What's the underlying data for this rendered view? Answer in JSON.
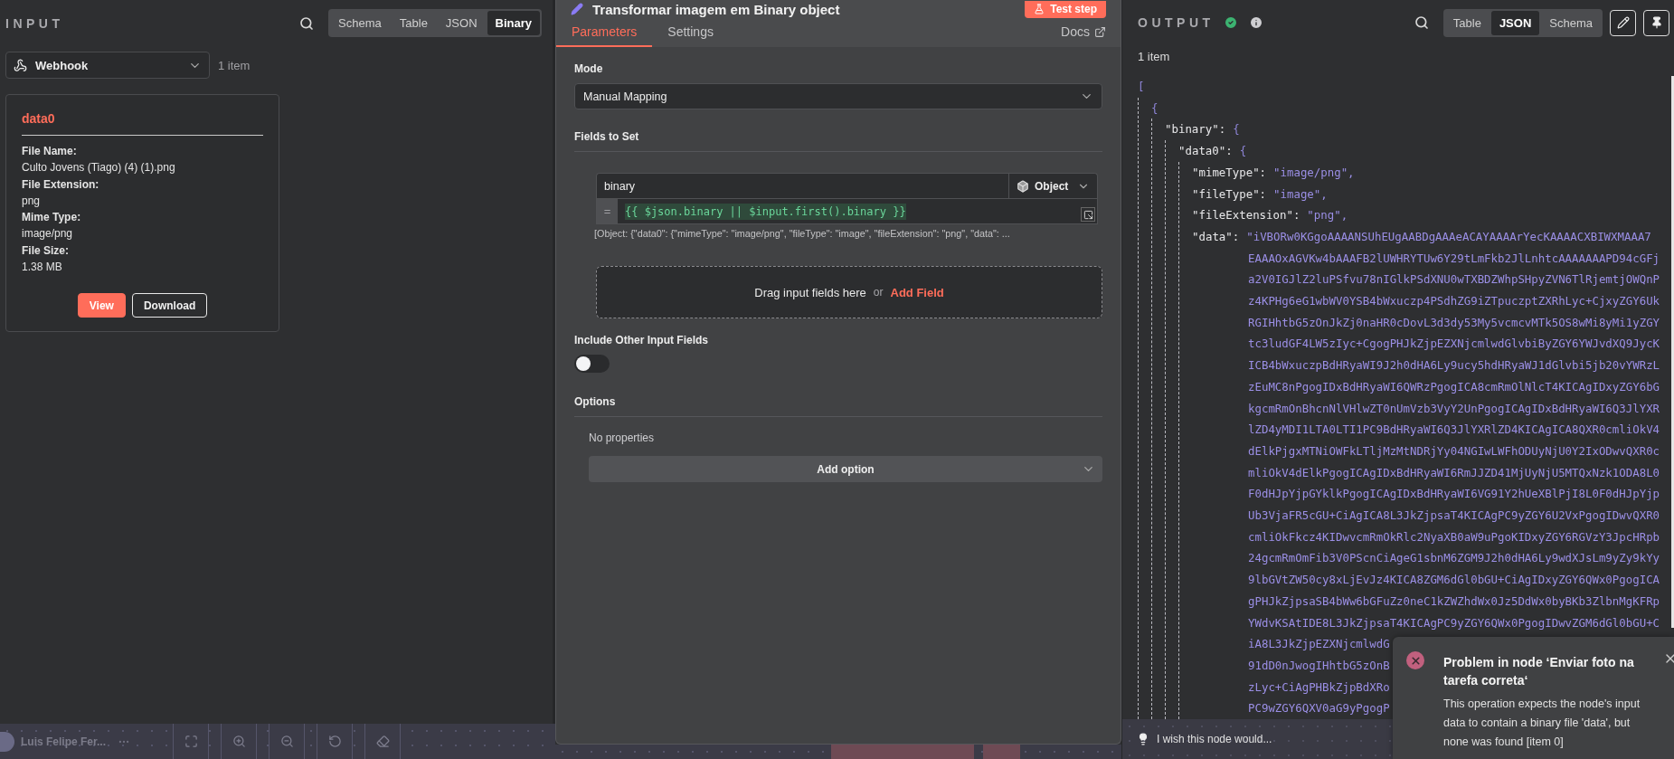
{
  "input": {
    "title": "INPUT",
    "view_tabs": [
      {
        "label": "Schema",
        "selected": false
      },
      {
        "label": "Table",
        "selected": false
      },
      {
        "label": "JSON",
        "selected": false
      },
      {
        "label": "Binary",
        "selected": true
      }
    ],
    "source": {
      "value": "Webhook"
    },
    "item_count": "1 item",
    "files": [
      {
        "name": "data0",
        "fields": [
          {
            "label": "File Name:",
            "value": "Culto Jovens (Tiago) (4) (1).png"
          },
          {
            "label": "File Extension:",
            "value": "png"
          },
          {
            "label": "Mime Type:",
            "value": "image/png"
          },
          {
            "label": "File Size:",
            "value": "1.38 MB"
          }
        ],
        "buttons": [
          {
            "label": "View",
            "kind": "primary"
          },
          {
            "label": "Download",
            "kind": "outline"
          }
        ]
      }
    ]
  },
  "node": {
    "title": "Transformar imagem em Binary object",
    "test_button": "Test step",
    "tabs": [
      {
        "label": "Parameters",
        "selected": true
      },
      {
        "label": "Settings",
        "selected": false
      }
    ],
    "docs_link": "Docs",
    "mode": {
      "label": "Mode",
      "value": "Manual Mapping"
    },
    "fields_to_set": {
      "label": "Fields to Set",
      "fields": [
        {
          "name": "binary",
          "type": "Object",
          "operator": "=",
          "expression": "{{ $json.binary || $input.first().binary }}",
          "preview": "[Object: {\"data0\": {\"mimeType\": \"image/png\", \"fileType\": \"image\", \"fileExtension\": \"png\", \"data\": ..."
        }
      ],
      "dropzone": {
        "text": "Drag input fields here",
        "separator": "or",
        "link": "Add Field"
      }
    },
    "include_other": {
      "label": "Include Other Input Fields",
      "on": false
    },
    "options": {
      "label": "Options",
      "empty_text": "No properties",
      "add_button": "Add option"
    }
  },
  "output": {
    "title": "OUTPUT",
    "view_tabs": [
      {
        "label": "Table",
        "selected": false
      },
      {
        "label": "JSON",
        "selected": true
      },
      {
        "label": "Schema",
        "selected": false
      }
    ],
    "item_count": "1 item",
    "json_tree": [
      {
        "kind": "open",
        "text": "[",
        "children": [
          {
            "kind": "open",
            "text": "{",
            "children": [
              {
                "kind": "open",
                "key": "\"binary\":",
                "text": "{",
                "children": [
                  {
                    "kind": "open",
                    "key": "\"data0\":",
                    "text": "{",
                    "children": [
                      {
                        "kind": "value",
                        "key": "\"mimeType\":",
                        "text": "\"image/png\","
                      },
                      {
                        "kind": "value",
                        "key": "\"fileType\":",
                        "text": "\"image\","
                      },
                      {
                        "kind": "value",
                        "key": "\"fileExtension\":",
                        "text": "\"png\","
                      },
                      {
                        "kind": "multiline",
                        "key": "\"data\":",
                        "text": "\"iVBORw0KGgoAAAANSUhEUgAABDgAAAeACAYAAAArYecKAAAACXBIWXMAAA7",
                        "lines": [
                          "EAAAOxAGVKw4bAAAFB2lUWHRYTUw6Y29tLmFkb2JlLnhtcAAAAAAAPD94cGFj",
                          "a2V0IGJlZ2luPSfvu78nIGlkPSdXNU0wTXBDZWhpSHpyZVN6TlRjemtjOWQnP",
                          "z4KPHg6eG1wbWV0YSB4bWxuczp4PSdhZG9iZTpuczptZXRhLyc+CjxyZGY6Uk",
                          "RGIHhtbG5zOnJkZj0naHR0cDovL3d3dy53My5vcmcvMTk5OS8wMi8yMi1yZGY",
                          "tc3ludGF4LW5zIyc+CgogPHJkZjpEZXNjcmlwdGlvbiByZGY6YWJvdXQ9JycK",
                          "ICB4bWxuczpBdHRyaWI9J2h0dHA6Ly9ucy5hdHRyaWJ1dGlvbi5jb20vYWRzL",
                          "zEuMC8nPgogIDxBdHRyaWI6QWRzPgogICA8cmRmOlNlcT4KICAgIDxyZGY6bG",
                          "kgcmRmOnBhcnNlVHlwZT0nUmVzb3VyY2UnPgogICAgIDxBdHRyaWI6Q3JlYXR",
                          "lZD4yMDI1LTA0LTI1PC9BdHRyaWI6Q3JlYXRlZD4KICAgICA8QXR0cmliOkV4",
                          "dElkPjgxMTNiOWFkLTljMzMtNDRjYy04NGIwLWFhODUyNjU0Y2IxODwvQXR0c",
                          "mliOkV4dElkPgogICAgIDxBdHRyaWI6RmJJZD41MjUyNjU5MTQxNzk1ODA8L0",
                          "F0dHJpYjpGYklkPgogICAgIDxBdHRyaWI6VG91Y2hUeXBlPjI8L0F0dHJpYjp",
                          "Ub3VjaFR5cGU+CiAgICA8L3JkZjpsaT4KICAgPC9yZGY6U2VxPgogIDwvQXR0",
                          "cmliOkFkcz4KIDwvcmRmOkRlc2NyaXB0aW9uPgoKIDxyZGY6RGVzY3JpcHRpb",
                          "24gcmRmOmFib3V0PScnCiAgeG1sbnM6ZGM9J2h0dHA6Ly9wdXJsLm9yZy9kYy",
                          "9lbGVtZW50cy8xLjEvJz4KICA8ZGM6dGl0bGU+CiAgIDxyZGY6QWx0PgogICA",
                          "gPHJkZjpsaSB4bWw6bGFuZz0neC1kZWZhdWx0Jz5DdWx0byBKb3ZlbnMgKFRp",
                          "YWdvKSAtIDE8L3JkZjpsaT4KICAgPC9yZGY6QWx0PgogIDwvZGM6dGl0bGU+C",
                          "iA8L3JkZjpEZXNjcmlwdG",
                          "91dD0nJwogIHhtbG5zOnB",
                          "zLyc+CiAgPHBkZjpBdXRo",
                          "PC9wZGY6QXV0aG9yPgogP"
                        ]
                      }
                    ]
                  }
                ]
              }
            ]
          }
        ]
      }
    ],
    "feedback_prompt": "I wish this node would..."
  },
  "canvas": {
    "user_name": "Luis Felipe Fer..."
  },
  "toast": {
    "title": "Problem in node ‘Enviar foto na tarefa correta‘",
    "message": "This operation expects the node's input data to contain a binary file 'data', but none was found [item 0]"
  }
}
